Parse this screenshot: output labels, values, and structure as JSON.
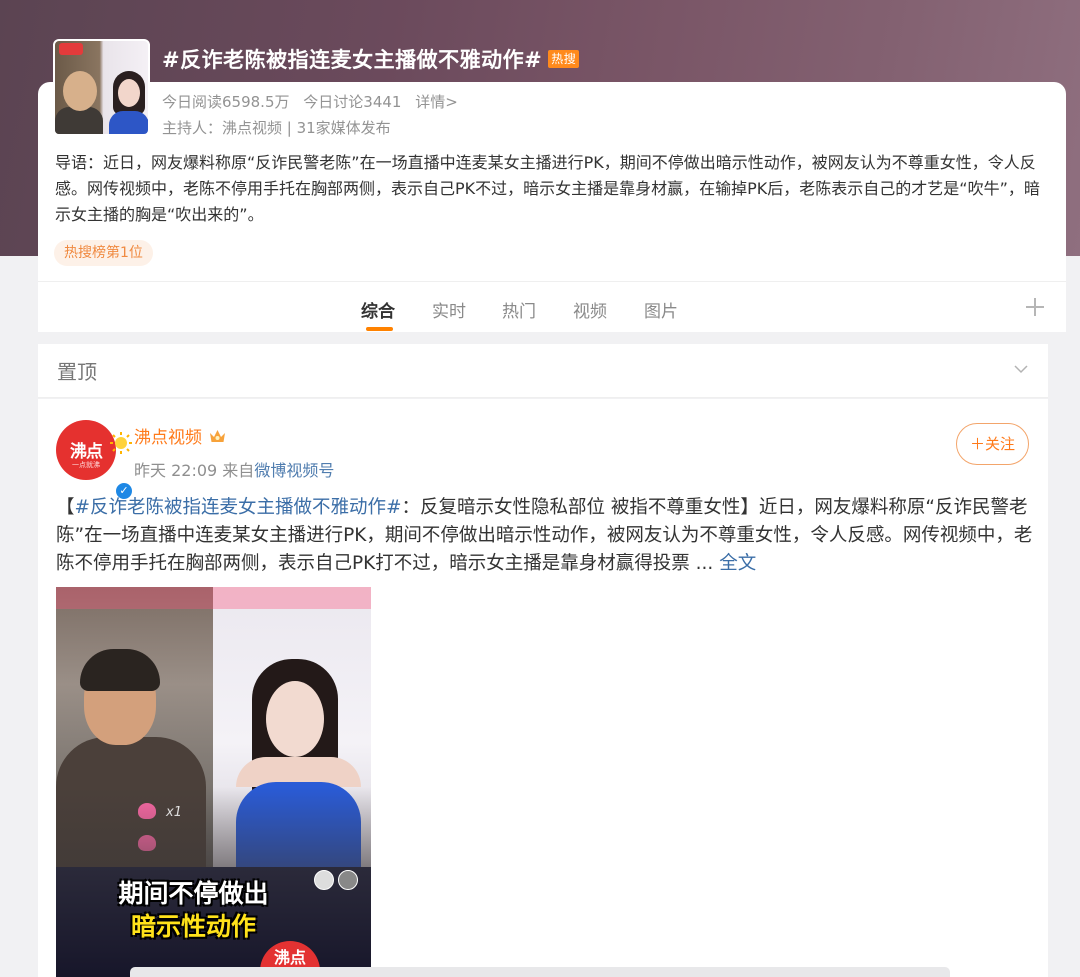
{
  "topic": {
    "title": "#反诈老陈被指连麦女主播做不雅动作#",
    "hot_badge": "热搜",
    "read_today": "今日阅读6598.5万",
    "discuss_today": "今日讨论3441",
    "details_link": "详情>",
    "host": "主持人：沸点视频 | 31家媒体发布",
    "intro": "导语：近日，网友爆料称原“反诈民警老陈”在一场直播中连麦某女主播进行PK，期间不停做出暗示性动作，被网友认为不尊重女性，令人反感。网传视频中，老陈不停用手托在胸部两侧，表示自己PK不过，暗示女主播是靠身材赢，在输掉PK后，老陈表示自己的才艺是“吹牛”，暗示女主播的胸是“吹出来的”。",
    "rank_tag": "热搜榜第1位"
  },
  "tabs": [
    {
      "label": "综合",
      "active": true
    },
    {
      "label": "实时",
      "active": false
    },
    {
      "label": "热门",
      "active": false
    },
    {
      "label": "视频",
      "active": false
    },
    {
      "label": "图片",
      "active": false
    }
  ],
  "pinned": {
    "label": "置顶"
  },
  "post": {
    "author": "沸点视频",
    "avatar_text": "沸点",
    "avatar_sub": "一点就沸",
    "time": "昨天 22:09",
    "source_prefix": "来自",
    "source": "微博视频号",
    "follow_label": "＋关注",
    "text_open": "【",
    "hashtag": "#反诈老陈被指连麦女主播做不雅动作#",
    "text_body": "：反复暗示女性隐私部位 被指不尊重女性】近日，网友爆料称原“反诈民警老陈”在一场直播中连麦某女主播进行PK，期间不停做出暗示性动作，被网友认为不尊重女性，令人反感。网传视频中，老陈不停用手托在胸部两侧，表示自己PK打不过，暗示女主播是靠身材赢得投票 ... ",
    "more_link": "全文",
    "video": {
      "caption_line1": "期间不停做出",
      "caption_line2": "暗示性动作",
      "logo_text": "沸点",
      "gift_count": "x1"
    }
  },
  "colors": {
    "accent": "#ff8200",
    "link": "#3b6ea7",
    "author": "#ff7a1a",
    "hot_badge": "#ff8a1c"
  }
}
